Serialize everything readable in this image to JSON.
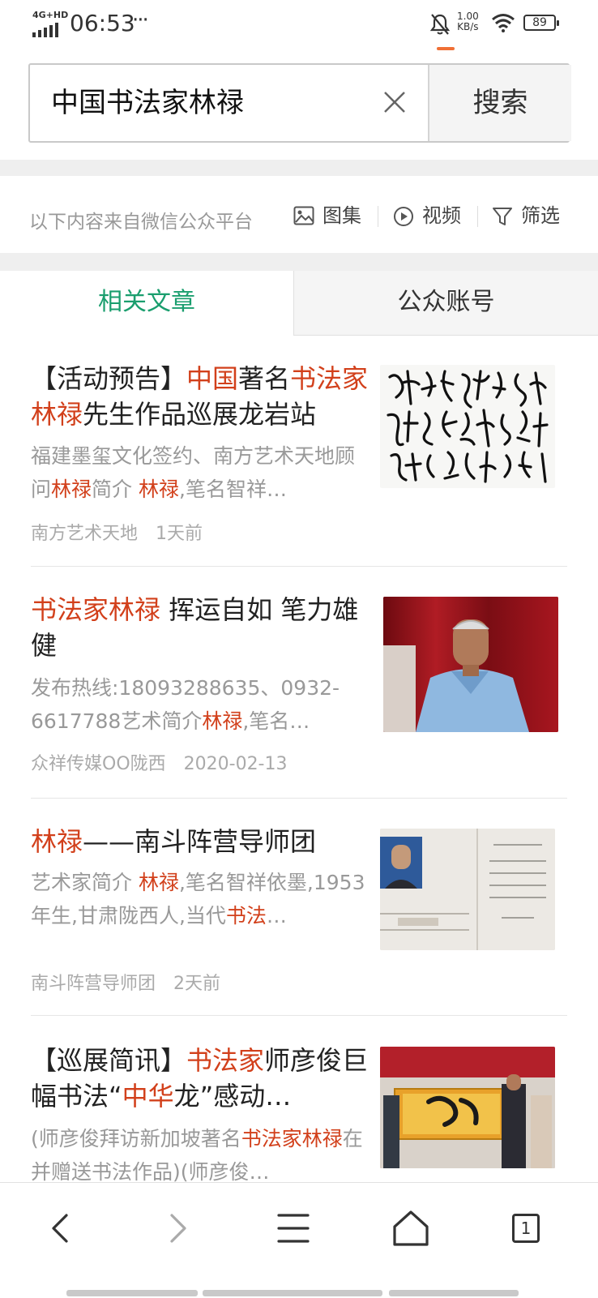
{
  "status_bar": {
    "network": "4G+HD",
    "time": "06:53",
    "more": "···",
    "speed_value": "1.00",
    "speed_unit": "KB/s",
    "battery": "89"
  },
  "search": {
    "query": "中国书法家林禄",
    "button_label": "搜索"
  },
  "filter_bar": {
    "source_note": "以下内容来自微信公众平台",
    "gallery": "图集",
    "video": "视频",
    "filter": "筛选"
  },
  "tabs": {
    "articles": "相关文章",
    "accounts": "公众账号"
  },
  "articles": [
    {
      "title": [
        {
          "t": "【活动预告】",
          "h": false
        },
        {
          "t": "中国",
          "h": true
        },
        {
          "t": "著名",
          "h": false
        },
        {
          "t": "书法家林禄",
          "h": true
        },
        {
          "t": "先生作品巡展龙岩站",
          "h": false
        }
      ],
      "desc": [
        {
          "t": "福建墨玺文化签约、南方艺术天地顾问",
          "h": false
        },
        {
          "t": "林禄",
          "h": true
        },
        {
          "t": "简介 ",
          "h": false
        },
        {
          "t": "林禄",
          "h": true
        },
        {
          "t": ",笔名智祥…",
          "h": false
        }
      ],
      "source": "南方艺术天地",
      "time": "1天前"
    },
    {
      "title": [
        {
          "t": "书法家林禄",
          "h": true
        },
        {
          "t": " 挥运自如 笔力雄健",
          "h": false
        }
      ],
      "desc": [
        {
          "t": "发布热线:18093288635、0932-6617788艺术简介",
          "h": false
        },
        {
          "t": "林禄",
          "h": true
        },
        {
          "t": ",笔名…",
          "h": false
        }
      ],
      "source": "众祥传媒OO陇西",
      "time": "2020-02-13"
    },
    {
      "title": [
        {
          "t": "林禄",
          "h": true
        },
        {
          "t": "——南斗阵营导师团",
          "h": false
        }
      ],
      "desc": [
        {
          "t": "艺术家简介 ",
          "h": false
        },
        {
          "t": "林禄",
          "h": true
        },
        {
          "t": ",笔名智祥依墨,1953年生,甘肃陇西人,当代",
          "h": false
        },
        {
          "t": "书法",
          "h": true
        },
        {
          "t": "…",
          "h": false
        }
      ],
      "source": "南斗阵营导师团",
      "time": "2天前"
    },
    {
      "title": [
        {
          "t": "【巡展简讯】",
          "h": false
        },
        {
          "t": "书法家",
          "h": true
        },
        {
          "t": "师彦俊巨幅书法“",
          "h": false
        },
        {
          "t": "中华",
          "h": true
        },
        {
          "t": "龙”感动…",
          "h": false
        }
      ],
      "desc": [
        {
          "t": "(师彦俊拜访新加坡著名",
          "h": false
        },
        {
          "t": "书法家林禄",
          "h": true
        },
        {
          "t": "在并赠送书法作品)(师彦俊…",
          "h": false
        }
      ],
      "source": "",
      "time": ""
    }
  ],
  "bottom_nav": {
    "tab_count": "1"
  }
}
